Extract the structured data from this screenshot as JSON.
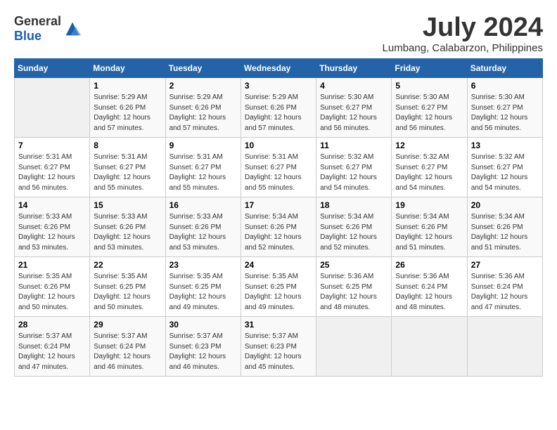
{
  "logo": {
    "general": "General",
    "blue": "Blue"
  },
  "title": {
    "month_year": "July 2024",
    "location": "Lumbang, Calabarzon, Philippines"
  },
  "days_of_week": [
    "Sunday",
    "Monday",
    "Tuesday",
    "Wednesday",
    "Thursday",
    "Friday",
    "Saturday"
  ],
  "weeks": [
    [
      {
        "day": "",
        "info": ""
      },
      {
        "day": "1",
        "info": "Sunrise: 5:29 AM\nSunset: 6:26 PM\nDaylight: 12 hours\nand 57 minutes."
      },
      {
        "day": "2",
        "info": "Sunrise: 5:29 AM\nSunset: 6:26 PM\nDaylight: 12 hours\nand 57 minutes."
      },
      {
        "day": "3",
        "info": "Sunrise: 5:29 AM\nSunset: 6:26 PM\nDaylight: 12 hours\nand 57 minutes."
      },
      {
        "day": "4",
        "info": "Sunrise: 5:30 AM\nSunset: 6:27 PM\nDaylight: 12 hours\nand 56 minutes."
      },
      {
        "day": "5",
        "info": "Sunrise: 5:30 AM\nSunset: 6:27 PM\nDaylight: 12 hours\nand 56 minutes."
      },
      {
        "day": "6",
        "info": "Sunrise: 5:30 AM\nSunset: 6:27 PM\nDaylight: 12 hours\nand 56 minutes."
      }
    ],
    [
      {
        "day": "7",
        "info": "Sunrise: 5:31 AM\nSunset: 6:27 PM\nDaylight: 12 hours\nand 56 minutes."
      },
      {
        "day": "8",
        "info": "Sunrise: 5:31 AM\nSunset: 6:27 PM\nDaylight: 12 hours\nand 55 minutes."
      },
      {
        "day": "9",
        "info": "Sunrise: 5:31 AM\nSunset: 6:27 PM\nDaylight: 12 hours\nand 55 minutes."
      },
      {
        "day": "10",
        "info": "Sunrise: 5:31 AM\nSunset: 6:27 PM\nDaylight: 12 hours\nand 55 minutes."
      },
      {
        "day": "11",
        "info": "Sunrise: 5:32 AM\nSunset: 6:27 PM\nDaylight: 12 hours\nand 54 minutes."
      },
      {
        "day": "12",
        "info": "Sunrise: 5:32 AM\nSunset: 6:27 PM\nDaylight: 12 hours\nand 54 minutes."
      },
      {
        "day": "13",
        "info": "Sunrise: 5:32 AM\nSunset: 6:27 PM\nDaylight: 12 hours\nand 54 minutes."
      }
    ],
    [
      {
        "day": "14",
        "info": "Sunrise: 5:33 AM\nSunset: 6:26 PM\nDaylight: 12 hours\nand 53 minutes."
      },
      {
        "day": "15",
        "info": "Sunrise: 5:33 AM\nSunset: 6:26 PM\nDaylight: 12 hours\nand 53 minutes."
      },
      {
        "day": "16",
        "info": "Sunrise: 5:33 AM\nSunset: 6:26 PM\nDaylight: 12 hours\nand 53 minutes."
      },
      {
        "day": "17",
        "info": "Sunrise: 5:34 AM\nSunset: 6:26 PM\nDaylight: 12 hours\nand 52 minutes."
      },
      {
        "day": "18",
        "info": "Sunrise: 5:34 AM\nSunset: 6:26 PM\nDaylight: 12 hours\nand 52 minutes."
      },
      {
        "day": "19",
        "info": "Sunrise: 5:34 AM\nSunset: 6:26 PM\nDaylight: 12 hours\nand 51 minutes."
      },
      {
        "day": "20",
        "info": "Sunrise: 5:34 AM\nSunset: 6:26 PM\nDaylight: 12 hours\nand 51 minutes."
      }
    ],
    [
      {
        "day": "21",
        "info": "Sunrise: 5:35 AM\nSunset: 6:26 PM\nDaylight: 12 hours\nand 50 minutes."
      },
      {
        "day": "22",
        "info": "Sunrise: 5:35 AM\nSunset: 6:25 PM\nDaylight: 12 hours\nand 50 minutes."
      },
      {
        "day": "23",
        "info": "Sunrise: 5:35 AM\nSunset: 6:25 PM\nDaylight: 12 hours\nand 49 minutes."
      },
      {
        "day": "24",
        "info": "Sunrise: 5:35 AM\nSunset: 6:25 PM\nDaylight: 12 hours\nand 49 minutes."
      },
      {
        "day": "25",
        "info": "Sunrise: 5:36 AM\nSunset: 6:25 PM\nDaylight: 12 hours\nand 48 minutes."
      },
      {
        "day": "26",
        "info": "Sunrise: 5:36 AM\nSunset: 6:24 PM\nDaylight: 12 hours\nand 48 minutes."
      },
      {
        "day": "27",
        "info": "Sunrise: 5:36 AM\nSunset: 6:24 PM\nDaylight: 12 hours\nand 47 minutes."
      }
    ],
    [
      {
        "day": "28",
        "info": "Sunrise: 5:37 AM\nSunset: 6:24 PM\nDaylight: 12 hours\nand 47 minutes."
      },
      {
        "day": "29",
        "info": "Sunrise: 5:37 AM\nSunset: 6:24 PM\nDaylight: 12 hours\nand 46 minutes."
      },
      {
        "day": "30",
        "info": "Sunrise: 5:37 AM\nSunset: 6:23 PM\nDaylight: 12 hours\nand 46 minutes."
      },
      {
        "day": "31",
        "info": "Sunrise: 5:37 AM\nSunset: 6:23 PM\nDaylight: 12 hours\nand 45 minutes."
      },
      {
        "day": "",
        "info": ""
      },
      {
        "day": "",
        "info": ""
      },
      {
        "day": "",
        "info": ""
      }
    ]
  ]
}
